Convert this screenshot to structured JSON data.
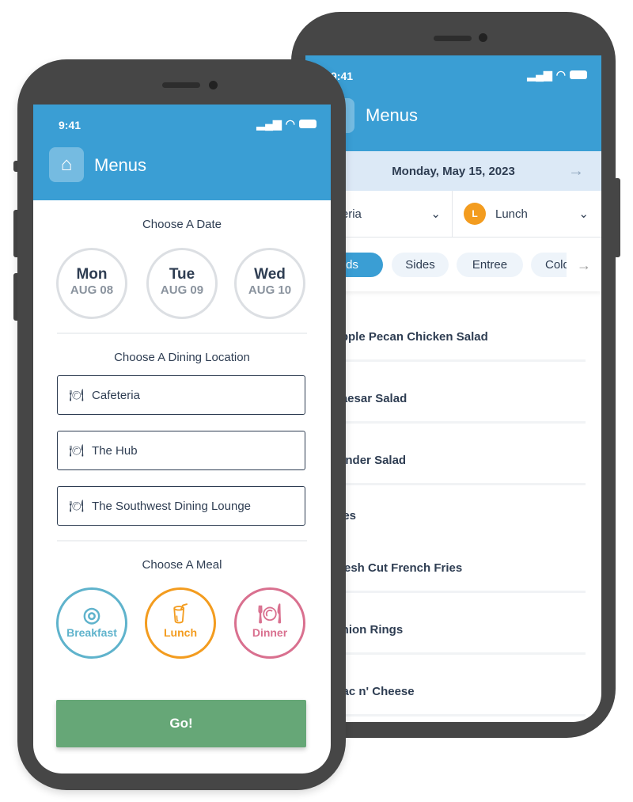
{
  "status": {
    "time": "9:41"
  },
  "back_screen": {
    "title": "Menus",
    "date": "Monday, May 15, 2023",
    "location_select": "Cafeteria",
    "meal_select": {
      "badge": "L",
      "label": "Lunch"
    },
    "chips": [
      "Salads",
      "Sides",
      "Entree",
      "Cold"
    ],
    "items": [
      "Apple Pecan Chicken Salad",
      "Caesar Salad",
      "Tender Salad",
      "Sides",
      "Fresh Cut French Fries",
      "Onion Rings",
      "Mac n' Cheese"
    ]
  },
  "front_screen": {
    "title": "Menus",
    "choose_date": "Choose A Date",
    "dates": [
      {
        "day": "Mon",
        "date": "AUG 08"
      },
      {
        "day": "Tue",
        "date": "AUG 09"
      },
      {
        "day": "Wed",
        "date": "AUG 10"
      }
    ],
    "choose_location": "Choose A Dining Location",
    "locations": [
      "Cafeteria",
      "The Hub",
      "The Southwest Dining Lounge"
    ],
    "choose_meal": "Choose A Meal",
    "meals": [
      {
        "label": "Breakfast",
        "color": "#5fb3cc"
      },
      {
        "label": "Lunch",
        "color": "#f39c1f"
      },
      {
        "label": "Dinner",
        "color": "#d9708f"
      }
    ],
    "go": "Go!"
  },
  "colors": {
    "header": "#3a9ed4",
    "go": "#66a777",
    "frame": "#464646"
  }
}
